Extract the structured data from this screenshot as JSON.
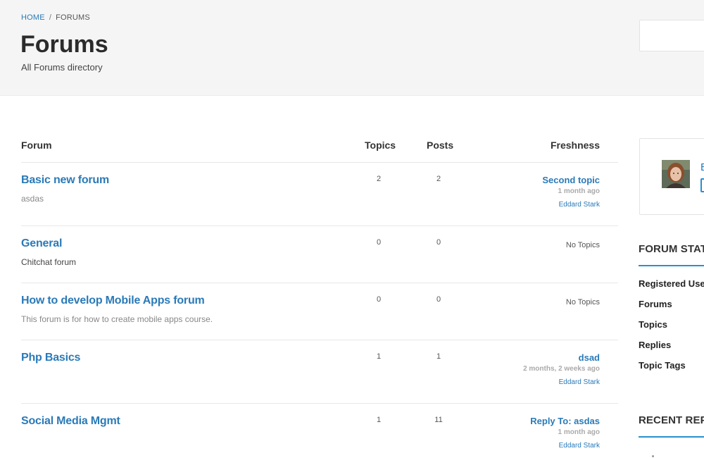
{
  "breadcrumb": {
    "home": "HOME",
    "separator": "/",
    "current": "FORUMS"
  },
  "header": {
    "title": "Forums",
    "subtitle": "All Forums directory"
  },
  "table": {
    "headers": {
      "forum": "Forum",
      "topics": "Topics",
      "posts": "Posts",
      "freshness": "Freshness"
    },
    "rows": [
      {
        "title": "Basic new forum",
        "description": "asdas",
        "topics": "2",
        "posts": "2",
        "fresh_topic": "Second topic",
        "fresh_ago": "1 month ago",
        "fresh_author": "Eddard Stark"
      },
      {
        "title": "General",
        "description": "Chitchat forum",
        "topics": "0",
        "posts": "0",
        "fresh_none": "No Topics"
      },
      {
        "title": "How to develop Mobile Apps forum",
        "description": "This forum is for how to create mobile apps course.",
        "topics": "0",
        "posts": "0",
        "fresh_none": "No Topics"
      },
      {
        "title": "Php Basics",
        "description": "",
        "topics": "1",
        "posts": "1",
        "fresh_topic": "dsad",
        "fresh_ago": "2 months, 2 weeks ago",
        "fresh_author": "Eddard Stark"
      },
      {
        "title": "Social Media Mgmt",
        "description": "",
        "topics": "1",
        "posts": "11",
        "fresh_topic": "Reply To: asdas",
        "fresh_ago": "1 month ago",
        "fresh_author": "Eddard Stark"
      }
    ]
  },
  "sidebar": {
    "user_name_initial": "E",
    "stats_title": "FORUM STAT",
    "stats_items": [
      "Registered Use",
      "Forums",
      "Topics",
      "Replies",
      "Topic Tags"
    ],
    "recent_title": "RECENT REP"
  },
  "colors": {
    "link": "#2a7ab8",
    "accent": "#2a8fd0",
    "header_bg": "#f5f5f5"
  }
}
